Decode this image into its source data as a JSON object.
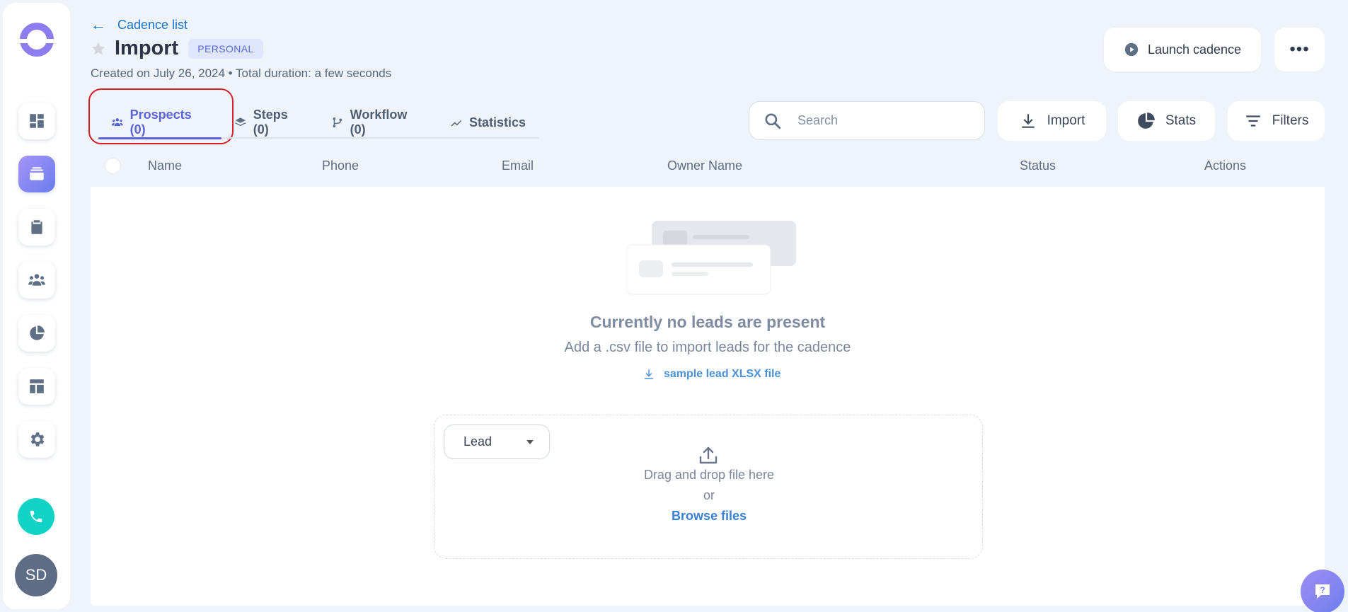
{
  "header": {
    "back_label": "Cadence list",
    "title": "Import",
    "badge": "PERSONAL",
    "created": "Created on July 26, 2024 • Total duration: a few seconds",
    "launch_label": "Launch cadence",
    "more_label": "•••"
  },
  "tabs": [
    {
      "label": "Prospects (0)",
      "icon": "people-icon",
      "active": true
    },
    {
      "label": "Steps (0)",
      "icon": "layers-icon"
    },
    {
      "label": "Workflow (0)",
      "icon": "branch-icon"
    },
    {
      "label": "Statistics",
      "icon": "trend-icon"
    }
  ],
  "toolbar": {
    "search_placeholder": "Search",
    "import_label": "Import",
    "stats_label": "Stats",
    "filters_label": "Filters"
  },
  "table": {
    "columns": [
      "Name",
      "Phone",
      "Email",
      "Owner Name",
      "Status",
      "Actions"
    ]
  },
  "empty": {
    "title": "Currently no leads are present",
    "subtitle": "Add a .csv file to import leads for the cadence",
    "sample_link": "sample lead XLSX file"
  },
  "upload": {
    "type_selected": "Lead",
    "drag_text": "Drag and drop file here",
    "or_text": "or",
    "browse_label": "Browse files"
  },
  "user": {
    "initials": "SD"
  },
  "colors": {
    "accent": "#5a63d9",
    "link": "#1a73c8",
    "phone": "#10d3c6",
    "highlight": "#d6202a"
  }
}
